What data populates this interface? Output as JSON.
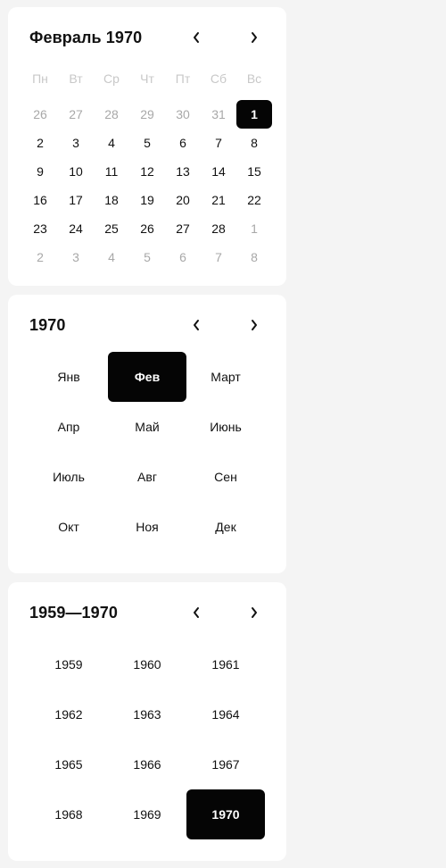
{
  "day_view": {
    "title": "Февраль 1970",
    "weekdays": [
      "Пн",
      "Вт",
      "Ср",
      "Чт",
      "Пт",
      "Сб",
      "Вс"
    ],
    "weeks": [
      [
        {
          "d": "26",
          "out": true
        },
        {
          "d": "27",
          "out": true
        },
        {
          "d": "28",
          "out": true
        },
        {
          "d": "29",
          "out": true
        },
        {
          "d": "30",
          "out": true
        },
        {
          "d": "31",
          "out": true
        },
        {
          "d": "1",
          "selected": true
        }
      ],
      [
        {
          "d": "2"
        },
        {
          "d": "3"
        },
        {
          "d": "4"
        },
        {
          "d": "5"
        },
        {
          "d": "6"
        },
        {
          "d": "7"
        },
        {
          "d": "8"
        }
      ],
      [
        {
          "d": "9"
        },
        {
          "d": "10"
        },
        {
          "d": "11"
        },
        {
          "d": "12"
        },
        {
          "d": "13"
        },
        {
          "d": "14"
        },
        {
          "d": "15"
        }
      ],
      [
        {
          "d": "16"
        },
        {
          "d": "17"
        },
        {
          "d": "18"
        },
        {
          "d": "19"
        },
        {
          "d": "20"
        },
        {
          "d": "21"
        },
        {
          "d": "22"
        }
      ],
      [
        {
          "d": "23"
        },
        {
          "d": "24"
        },
        {
          "d": "25"
        },
        {
          "d": "26"
        },
        {
          "d": "27"
        },
        {
          "d": "28"
        },
        {
          "d": "1",
          "out": true
        }
      ],
      [
        {
          "d": "2",
          "out": true
        },
        {
          "d": "3",
          "out": true
        },
        {
          "d": "4",
          "out": true
        },
        {
          "d": "5",
          "out": true
        },
        {
          "d": "6",
          "out": true
        },
        {
          "d": "7",
          "out": true
        },
        {
          "d": "8",
          "out": true
        }
      ]
    ]
  },
  "month_view": {
    "title": "1970",
    "months": [
      "Янв",
      "Фев",
      "Март",
      "Апр",
      "Май",
      "Июнь",
      "Июль",
      "Авг",
      "Сен",
      "Окт",
      "Ноя",
      "Дек"
    ],
    "selected_index": 1
  },
  "year_view": {
    "title": "1959—1970",
    "years": [
      "1959",
      "1960",
      "1961",
      "1962",
      "1963",
      "1964",
      "1965",
      "1966",
      "1967",
      "1968",
      "1969",
      "1970"
    ],
    "selected_index": 11
  },
  "icons": {
    "prev": "chevron-left-icon",
    "next": "chevron-right-icon"
  },
  "colors": {
    "selected_bg": "#050505",
    "selected_text": "#ffffff",
    "muted_text": "#a8a8a8",
    "weekday_text": "#c8c8c8",
    "page_bg": "#f4f4f4",
    "card_bg": "#ffffff"
  }
}
